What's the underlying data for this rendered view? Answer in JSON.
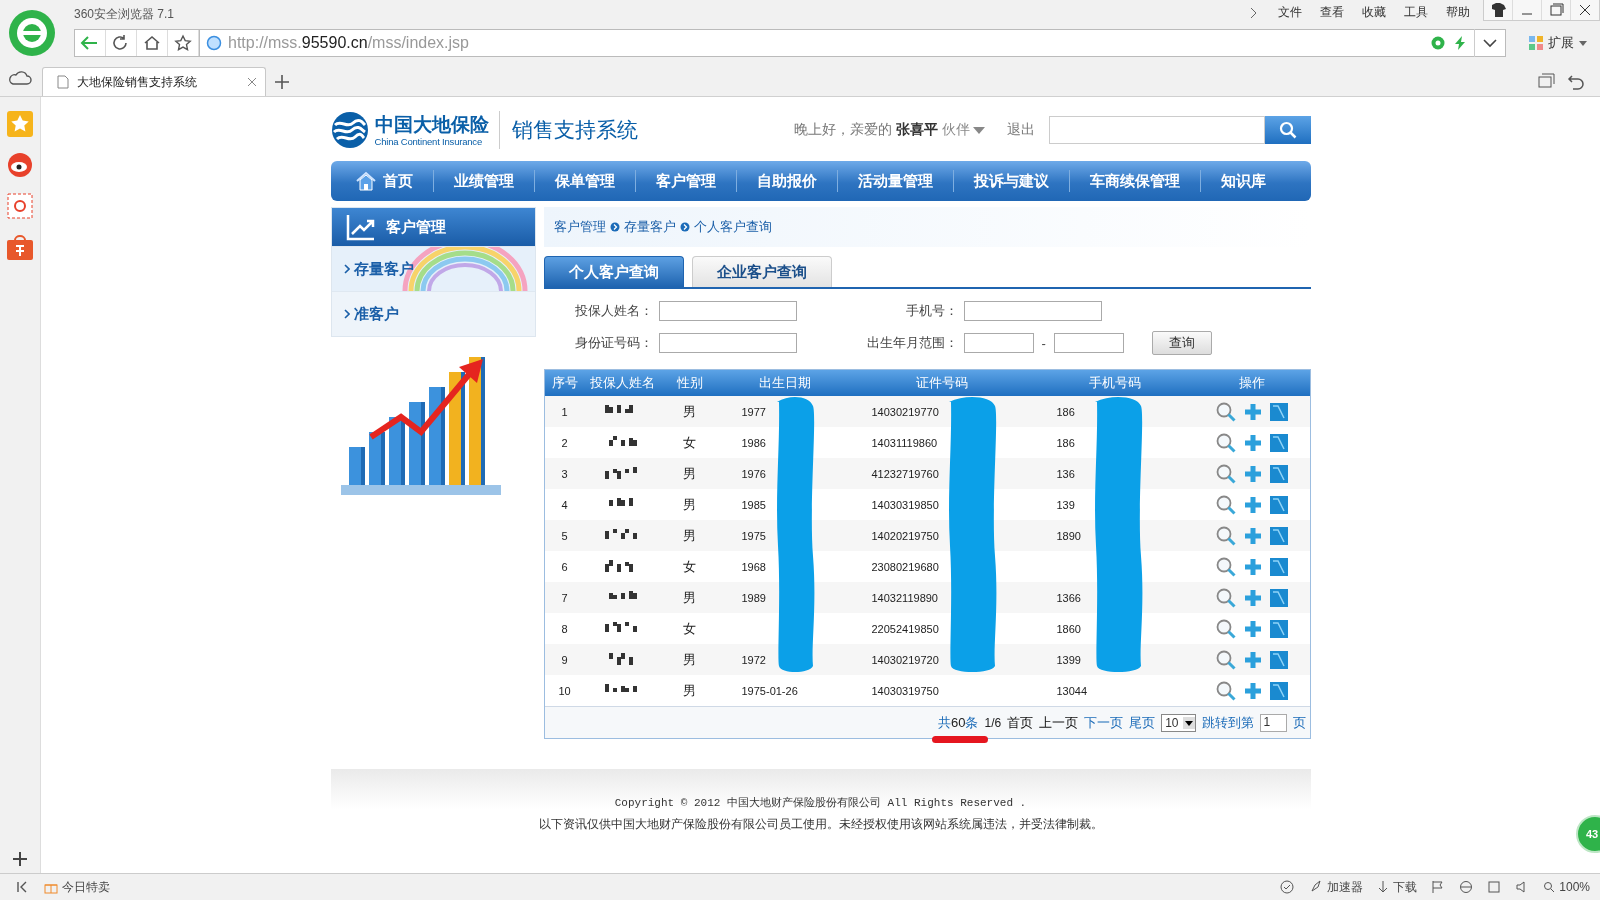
{
  "browser": {
    "app_title": "360安全浏览器 7.1",
    "menu": [
      "文件",
      "查看",
      "收藏",
      "工具",
      "帮助"
    ],
    "url": {
      "scheme": "http://mss.",
      "domain": "95590.cn",
      "path": "/mss/index.jsp"
    },
    "extension_label": "扩展",
    "tabs": [
      {
        "title": "大地保险销售支持系统",
        "selected": true
      }
    ]
  },
  "header": {
    "logo_cn": "中国大地保险",
    "logo_en": "China Continent Insurance",
    "system_title": "销售支持系统",
    "greeting": "晚上好，亲爱的",
    "user_name": "张喜平",
    "role": "伙伴",
    "logout": "退出"
  },
  "nav": [
    {
      "label": "首页",
      "kind": "home"
    },
    {
      "label": "业绩管理"
    },
    {
      "label": "保单管理"
    },
    {
      "label": "客户管理"
    },
    {
      "label": "自助报价"
    },
    {
      "label": "活动量管理"
    },
    {
      "label": "投诉与建议"
    },
    {
      "label": "车商续保管理"
    },
    {
      "label": "知识库"
    }
  ],
  "side_menu": {
    "title": "客户管理",
    "items": [
      {
        "label": "存量客户",
        "selected": true
      },
      {
        "label": "准客户",
        "selected": false
      }
    ]
  },
  "breadcrumb": [
    "客户管理",
    "存量客户",
    "个人客户查询"
  ],
  "query_tabs": [
    {
      "label": "个人客户查询",
      "selected": true
    },
    {
      "label": "企业客户查询",
      "selected": false
    }
  ],
  "form": {
    "name_label": "投保人姓名：",
    "phone_label": "手机号：",
    "id_label": "身份证号码：",
    "birth_label": "出生年月范围：",
    "range_sep": "-",
    "query_button": "查询"
  },
  "table": {
    "columns": [
      "序号",
      "投保人姓名",
      "性别",
      "出生日期",
      "证件号码",
      "手机号码",
      "操作"
    ],
    "rows": [
      {
        "no": "1",
        "name_hidden": true,
        "gender": "男",
        "birth": "1977",
        "id": "14030219770",
        "phone": "186"
      },
      {
        "no": "2",
        "name_hidden": true,
        "gender": "女",
        "birth": "1986",
        "id": "14031119860",
        "phone": "186"
      },
      {
        "no": "3",
        "name_hidden": true,
        "gender": "男",
        "birth": "1976",
        "id": "41232719760",
        "phone": "136"
      },
      {
        "no": "4",
        "name_hidden": true,
        "gender": "男",
        "birth": "1985",
        "id": "14030319850",
        "phone": "139"
      },
      {
        "no": "5",
        "name_hidden": true,
        "gender": "男",
        "birth": "1975",
        "id": "14020219750",
        "phone": "1890"
      },
      {
        "no": "6",
        "name_hidden": true,
        "gender": "女",
        "birth": "1968",
        "id": "23080219680"
      },
      {
        "no": "7",
        "name_hidden": true,
        "gender": "男",
        "birth": "1989",
        "id": "14032119890",
        "phone": "1366"
      },
      {
        "no": "8",
        "name_hidden": true,
        "gender": "女",
        "id": "22052419850",
        "phone": "1860"
      },
      {
        "no": "9",
        "name_hidden": true,
        "gender": "男",
        "birth": "1972",
        "id": "14030219720",
        "phone": "1399"
      },
      {
        "no": "10",
        "name_hidden": true,
        "gender": "男",
        "birth": "1975-01-26",
        "id": "14030319750",
        "phone": "13044"
      }
    ]
  },
  "pager": {
    "total_prefix": "共",
    "total": "60",
    "total_suffix": "条",
    "page": "1/6",
    "first": "首页",
    "prev": "上一页",
    "next": "下一页",
    "last": "尾页",
    "page_size": "10",
    "jump_label": "跳转到第",
    "jump_value": "1",
    "jump_suffix": "页"
  },
  "footer": [
    "Copyright © 2012 中国大地财产保险股份有限公司 All Rights Reserved .",
    "以下资讯仅供中国大地财产保险股份有限公司员工使用。未经授权使用该网站系统属违法，并受法律制裁。"
  ],
  "float_badge": "43",
  "status_bar": {
    "deals": "今日特卖",
    "accelerator": "加速器",
    "download": "下载",
    "zoom": "100%"
  }
}
